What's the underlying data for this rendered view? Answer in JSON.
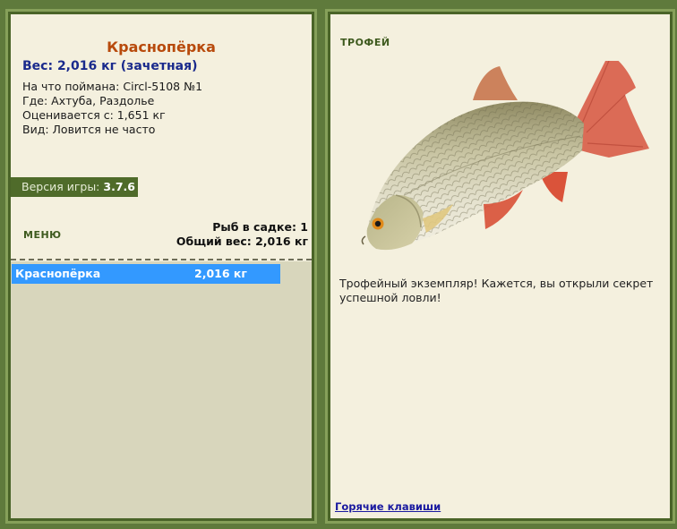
{
  "left": {
    "fish_name": "Краснопёрка",
    "weight_line": "Вес: 2,016 кг (зачетная)",
    "caught_on": "На что поймана: Circl-5108 №1",
    "location": "Где: Ахтуба, Раздолье",
    "rated_from": "Оценивается с: 1,651 кг",
    "species_note": "Вид: Ловится не часто",
    "version_label": "Версия игры:",
    "version_value": "3.7.6",
    "menu_label": "МЕНЮ",
    "fish_in_net": "Рыб в садке: 1",
    "total_weight": "Общий вес: 2,016 кг",
    "catch_list": [
      {
        "name": "Краснопёрка",
        "weight": "2,016 кг"
      }
    ]
  },
  "right": {
    "trophy_label": "ТРОФЕЙ",
    "trophy_message": "Трофейный экземпляр! Кажется, вы открыли секрет успешной ловли!",
    "hotkeys_link": "Горячие клавиши"
  },
  "colors": {
    "frame": "#5f7a3c",
    "panel": "#f4f0de",
    "fish_name": "#b84a0c",
    "weight": "#1a2a8c",
    "selection": "#3399ff",
    "list_bg": "#d8d6bc"
  }
}
